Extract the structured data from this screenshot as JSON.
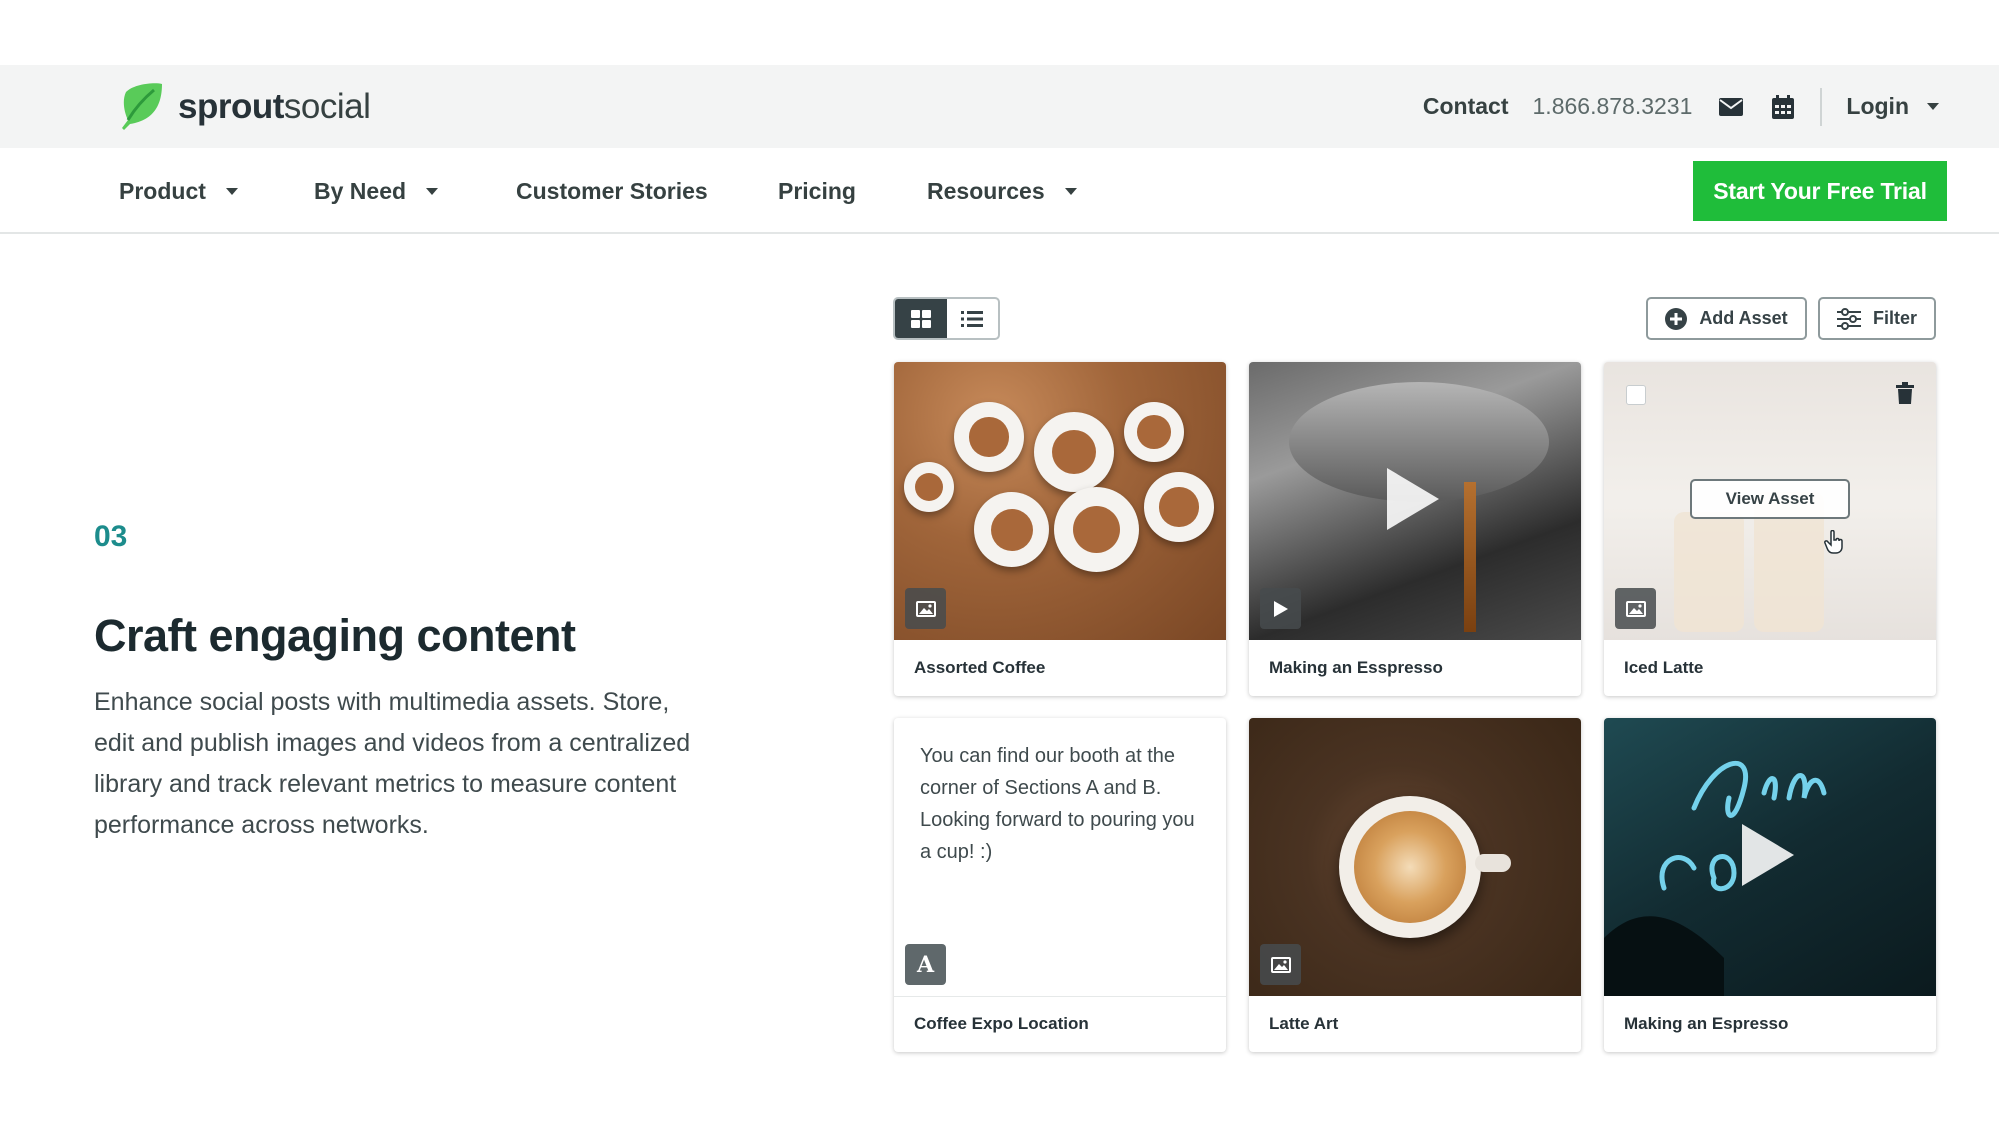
{
  "brand": {
    "name_bold": "sprout",
    "name_rest": "social",
    "accent": "#1fbd3a",
    "teal": "#1c8c8c"
  },
  "topbar": {
    "contact_label": "Contact",
    "phone": "1.866.878.3231",
    "login_label": "Login",
    "icons": [
      "envelope-icon",
      "calendar-icon",
      "chevron-down-icon"
    ]
  },
  "nav": {
    "items": [
      {
        "label": "Product",
        "has_dropdown": true
      },
      {
        "label": "By Need",
        "has_dropdown": true
      },
      {
        "label": "Customer Stories",
        "has_dropdown": false
      },
      {
        "label": "Pricing",
        "has_dropdown": false
      },
      {
        "label": "Resources",
        "has_dropdown": true
      }
    ],
    "cta_label": "Start Your Free Trial"
  },
  "feature": {
    "step": "03",
    "title": "Craft engaging content",
    "description": "Enhance social posts with multimedia assets. Store, edit and publish images and videos from a centralized library and track relevant metrics to measure content performance across networks."
  },
  "asset_library": {
    "view_mode": "grid",
    "add_asset_label": "Add Asset",
    "filter_label": "Filter",
    "view_asset_label": "View Asset",
    "cards": [
      {
        "label": "Assorted Coffee",
        "type": "image"
      },
      {
        "label": "Making an Esspresso",
        "type": "video"
      },
      {
        "label": "Iced Latte",
        "type": "image"
      },
      {
        "label": "Coffee Expo Location",
        "type": "text",
        "text": "You can find our booth at the corner of Sections A and B. Looking forward to pouring you a cup! :)",
        "badge_letter": "A"
      },
      {
        "label": "Latte Art",
        "type": "image"
      },
      {
        "label": "Making an Espresso",
        "type": "video"
      }
    ]
  }
}
